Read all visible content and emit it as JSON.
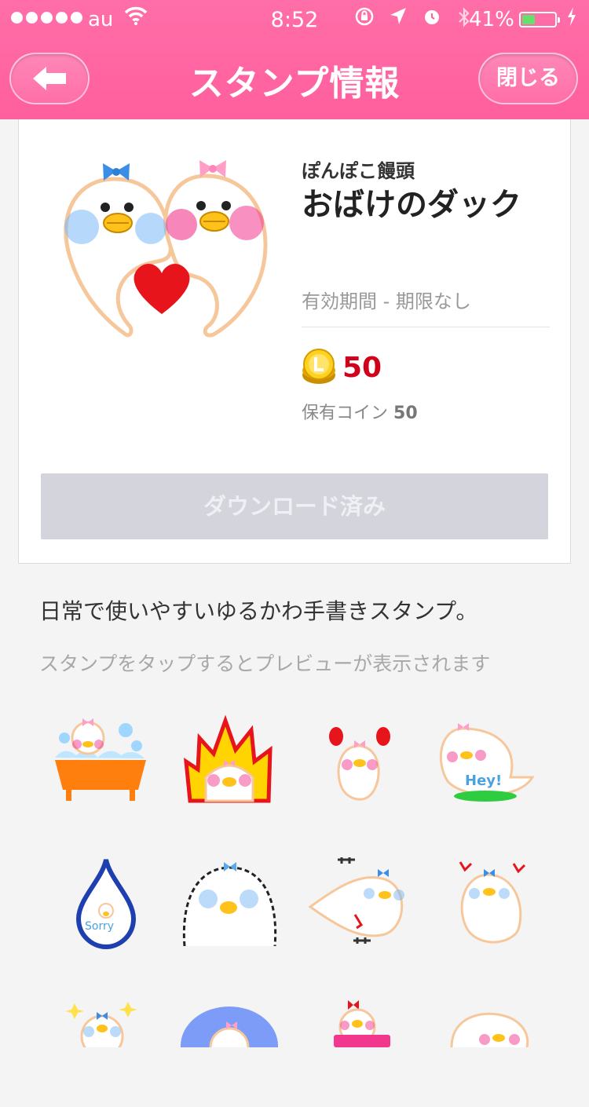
{
  "status": {
    "carrier": "au",
    "time": "8:52",
    "battery": "41%",
    "battery_level": 0.41
  },
  "nav": {
    "title": "スタンプ情報",
    "close_label": "閉じる"
  },
  "sticker": {
    "author": "ぽんぽこ饅頭",
    "name": "おばけのダック",
    "validity": "有効期間 - 期限なし",
    "price": "50",
    "owned_label": "保有コイン",
    "owned_value": "50",
    "download_label": "ダウンロード済み"
  },
  "description": "日常で使いやすいゆるかわ手書きスタンプ。",
  "preview_hint": "スタンプをタップするとプレビューが表示されます",
  "grid_texts": {
    "hey": "Hey!",
    "sorry": "Sorry"
  },
  "colors": {
    "accent": "#ff5f9d",
    "price": "#d0021b",
    "button_disabled": "#d3d4dc"
  }
}
